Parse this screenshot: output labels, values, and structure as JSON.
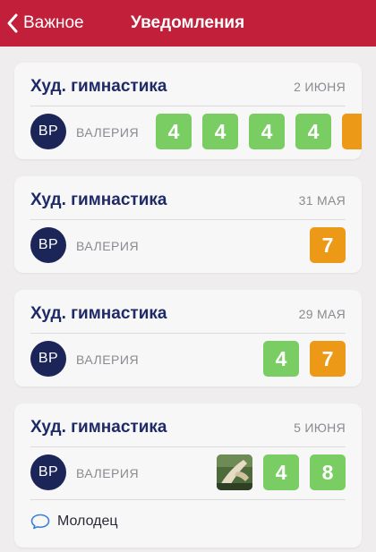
{
  "colors": {
    "navbar": "#c11f3a",
    "title_text": "#1e2a66",
    "avatar_bg": "#1b2558",
    "grade_green": "#79cd62",
    "grade_orange": "#ec9918"
  },
  "navbar": {
    "back_label": "Важное",
    "title": "Уведомления",
    "back_icon": "chevron-left-icon"
  },
  "notifications": [
    {
      "title": "Худ. гимнастика",
      "date": "2 ИЮНЯ",
      "avatar": "ВР",
      "author": "ВАЛЕРИЯ",
      "grades": [
        {
          "value": "4",
          "color": "green"
        },
        {
          "value": "4",
          "color": "green"
        },
        {
          "value": "4",
          "color": "green"
        },
        {
          "value": "4",
          "color": "green"
        },
        {
          "value": "",
          "color": "orange"
        }
      ]
    },
    {
      "title": "Худ. гимнастика",
      "date": "31 МАЯ",
      "avatar": "ВР",
      "author": "ВАЛЕРИЯ",
      "grades": [
        {
          "value": "7",
          "color": "orange"
        }
      ]
    },
    {
      "title": "Худ. гимнастика",
      "date": "29 МАЯ",
      "avatar": "ВР",
      "author": "ВАЛЕРИЯ",
      "grades": [
        {
          "value": "4",
          "color": "green"
        },
        {
          "value": "7",
          "color": "orange"
        }
      ]
    },
    {
      "title": "Худ. гимнастика",
      "date": "5 ИЮНЯ",
      "avatar": "ВР",
      "author": "ВАЛЕРИЯ",
      "attachment_icon": "photo-thumbnail",
      "grades": [
        {
          "value": "4",
          "color": "green"
        },
        {
          "value": "8",
          "color": "green"
        }
      ],
      "comment": "Молодец",
      "comment_icon": "speech-bubble-icon"
    }
  ]
}
